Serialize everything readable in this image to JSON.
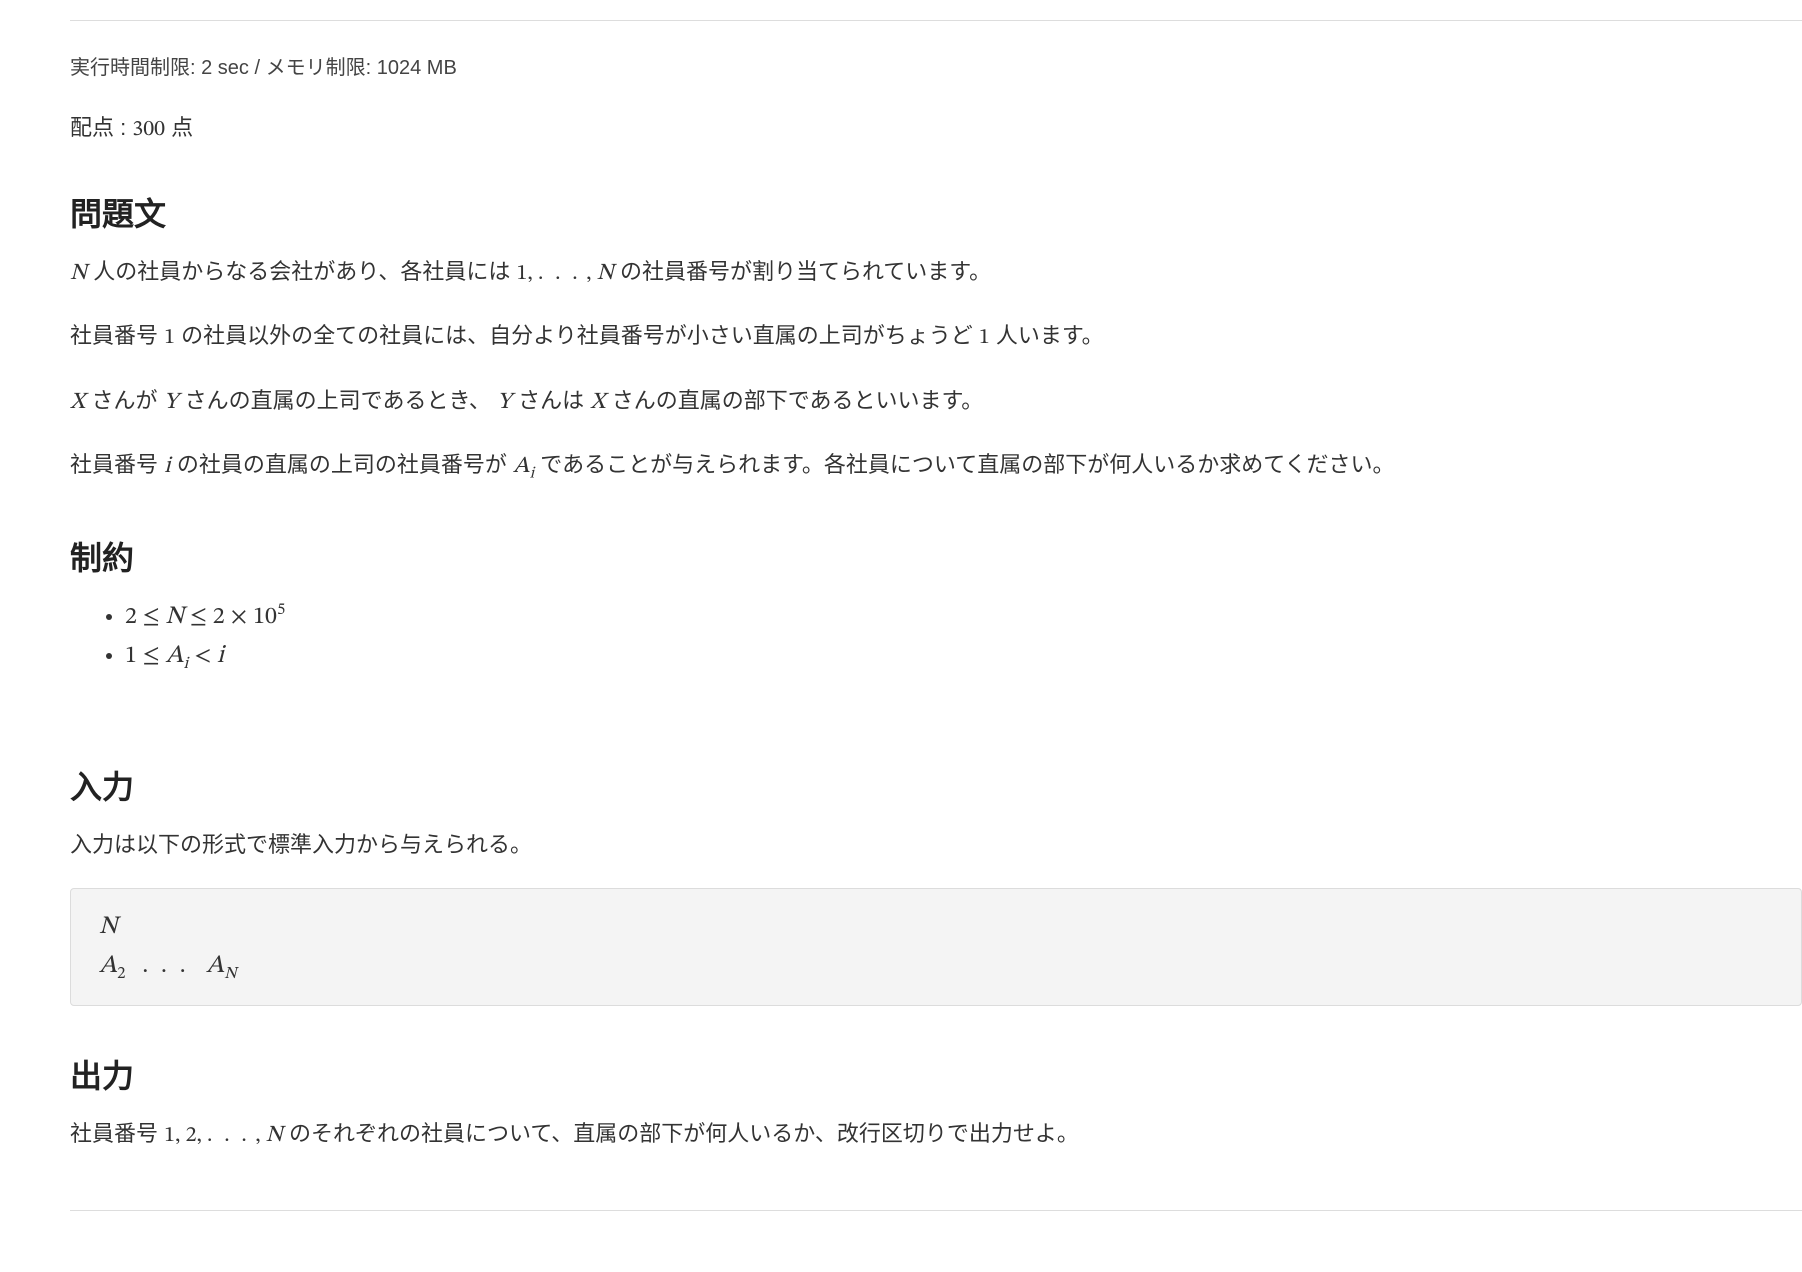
{
  "limits": {
    "time_label": "実行時間制限:",
    "time_value": "2 sec",
    "sep": "/",
    "memory_label": "メモリ制限:",
    "memory_value": "1024 MB"
  },
  "score": {
    "label_prefix": "配点 :",
    "value": "300",
    "label_suffix": " 点"
  },
  "sections": {
    "problem": {
      "heading": "問題文",
      "p1_a": " 人の社員からなる会社があり、各社員には ",
      "p1_b": " の社員番号が割り当てられています。",
      "p2_a": "社員番号 ",
      "p2_b": " の社員以外の全ての社員には、自分より社員番号が小さい直属の上司がちょうど ",
      "p2_c": " 人います。",
      "p3_a": " さんが ",
      "p3_b": " さんの直属の上司であるとき、",
      "p3_c": " さんは ",
      "p3_d": " さんの直属の部下であるといいます。",
      "p4_a": "社員番号 ",
      "p4_b": " の社員の直属の上司の社員番号が ",
      "p4_c": " であることが与えられます。各社員について直属の部下が何人いるか求めてください。"
    },
    "constraints": {
      "heading": "制約",
      "c1": "2 ≤ N ≤ 2 × 10^5",
      "c2": "1 ≤ A_i < i"
    },
    "input": {
      "heading": "入力",
      "desc": "入力は以下の形式で標準入力から与えられる。"
    },
    "output": {
      "heading": "出力",
      "desc_a": "社員番号 ",
      "desc_b": " のそれぞれの社員について、直属の部下が何人いるか、改行区切りで出力せよ。"
    }
  },
  "math": {
    "N": "N",
    "one": "1",
    "X": "X",
    "Y": "Y",
    "i": "i",
    "A": "A",
    "two": "2",
    "leq": "≤",
    "lt": "<",
    "times": "×",
    "ten": "10",
    "five": "5",
    "ldots": ". . .",
    "comma_ldots": "1, . . . , N",
    "seq_12N": "1, 2, . . . , N"
  }
}
